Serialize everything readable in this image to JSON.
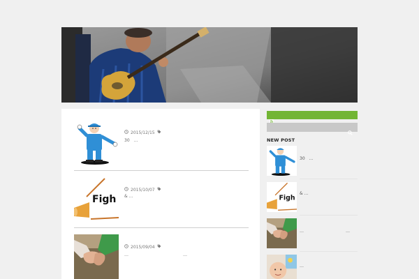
{
  "header": {
    "image_alt": "guitarist-photo"
  },
  "posts": [
    {
      "date": "2015/12/15",
      "excerpt": "30　…"
    },
    {
      "date": "2015/10/07",
      "excerpt": "& …"
    },
    {
      "date": "2015/09/04",
      "excerpt": "…　　　　　　　　　　　　　…"
    }
  ],
  "post_thumb_texts": {
    "fight_banner": "Figh"
  },
  "sidebar": {
    "rss_icon": "rss-icon",
    "search_icon": "search-icon",
    "widget_title": "NEW POST",
    "items": [
      {
        "text": "30　…"
      },
      {
        "text": "& …"
      },
      {
        "text": "…　　　　　　　　　　…"
      },
      {
        "text": "…"
      }
    ],
    "fight_banner_text": "Figh"
  },
  "colors": {
    "rss_bar": "#72b534",
    "search_bar": "#c8c8c8",
    "page_bg": "#f0f0f0",
    "content_bg": "#ffffff"
  }
}
